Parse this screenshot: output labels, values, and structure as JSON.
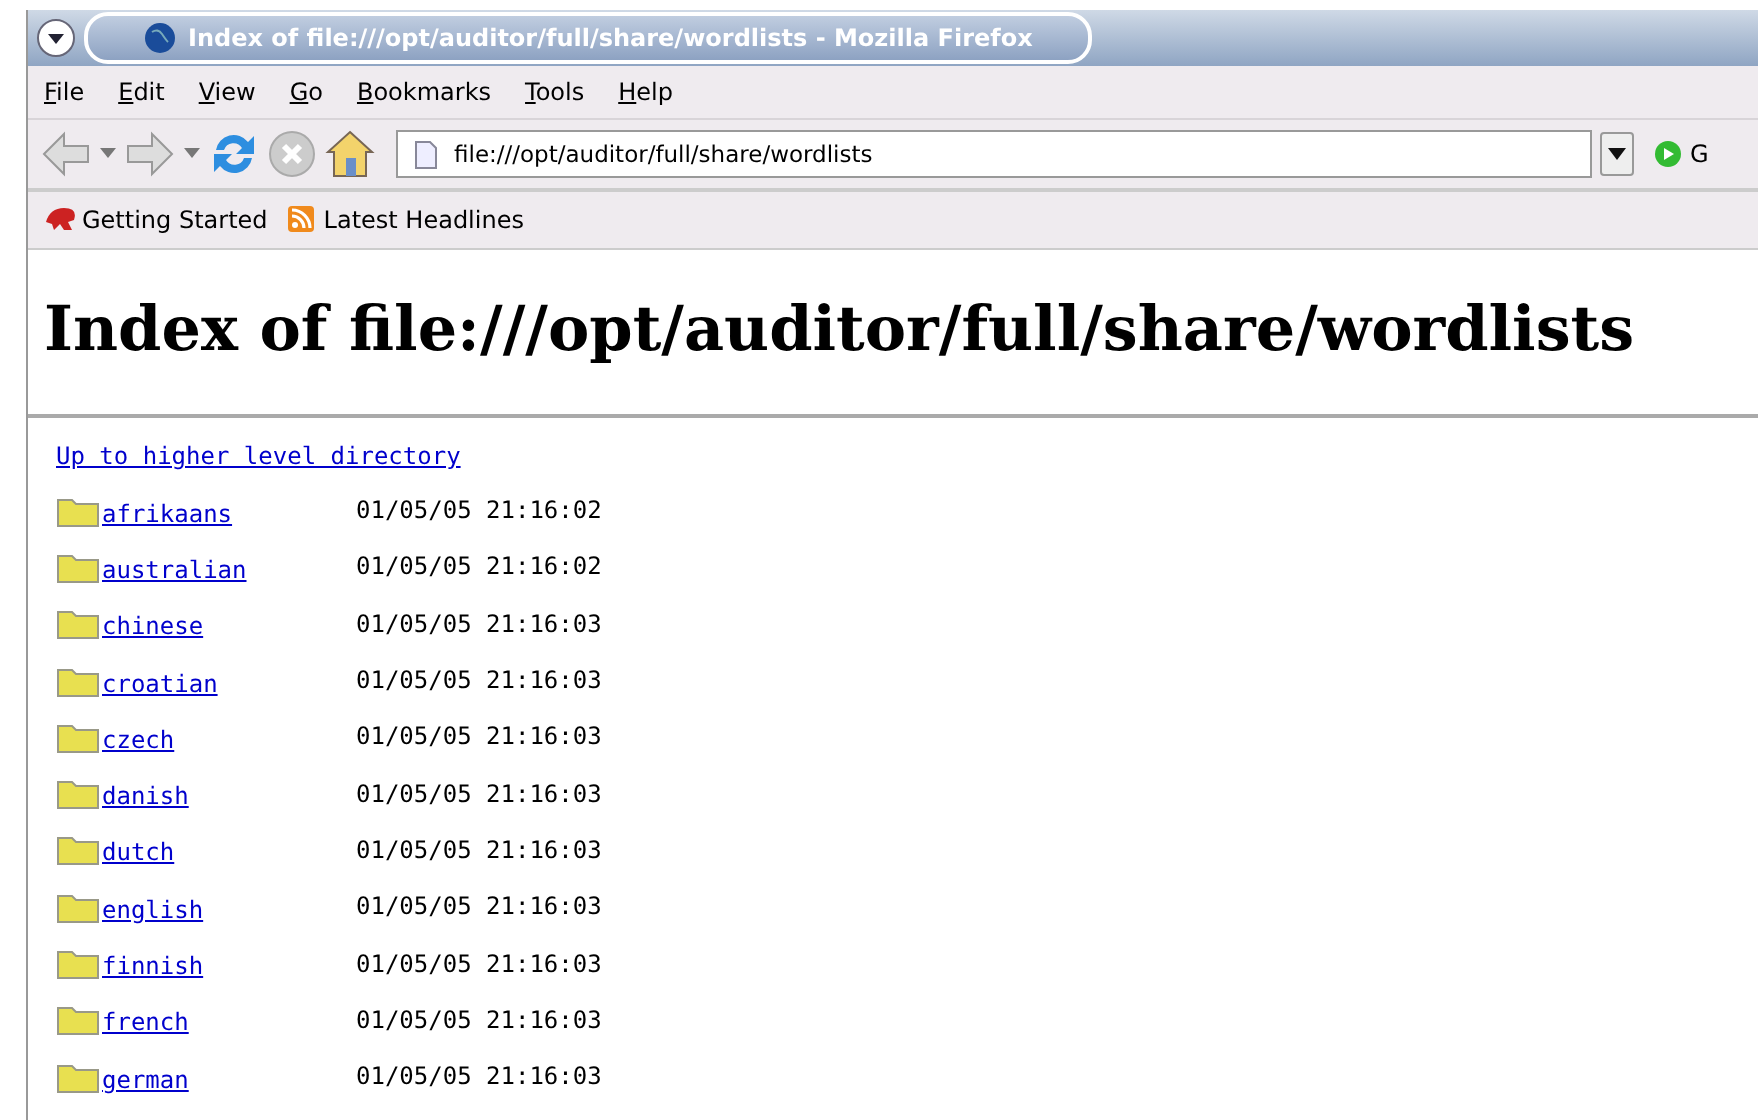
{
  "window": {
    "title": "Index of file:///opt/auditor/full/share/wordlists - Mozilla Firefox"
  },
  "menu": [
    "File",
    "Edit",
    "View",
    "Go",
    "Bookmarks",
    "Tools",
    "Help"
  ],
  "address": {
    "value": "file:///opt/auditor/full/share/wordlists"
  },
  "go_button": "G",
  "bookmarks": [
    "Getting Started",
    "Latest Headlines"
  ],
  "page": {
    "heading": "Index of file:///opt/auditor/full/share/wordlists",
    "up_link": "Up to higher level directory",
    "entries": [
      {
        "name": "afrikaans",
        "date": "01/05/05 21:16:02"
      },
      {
        "name": "australian",
        "date": "01/05/05 21:16:02"
      },
      {
        "name": "chinese",
        "date": "01/05/05 21:16:03"
      },
      {
        "name": "croatian",
        "date": "01/05/05 21:16:03"
      },
      {
        "name": "czech",
        "date": "01/05/05 21:16:03"
      },
      {
        "name": "danish",
        "date": "01/05/05 21:16:03"
      },
      {
        "name": "dutch",
        "date": "01/05/05 21:16:03"
      },
      {
        "name": "english",
        "date": "01/05/05 21:16:03"
      },
      {
        "name": "finnish",
        "date": "01/05/05 21:16:03"
      },
      {
        "name": "french",
        "date": "01/05/05 21:16:03"
      },
      {
        "name": "german",
        "date": "01/05/05 21:16:03"
      }
    ]
  }
}
